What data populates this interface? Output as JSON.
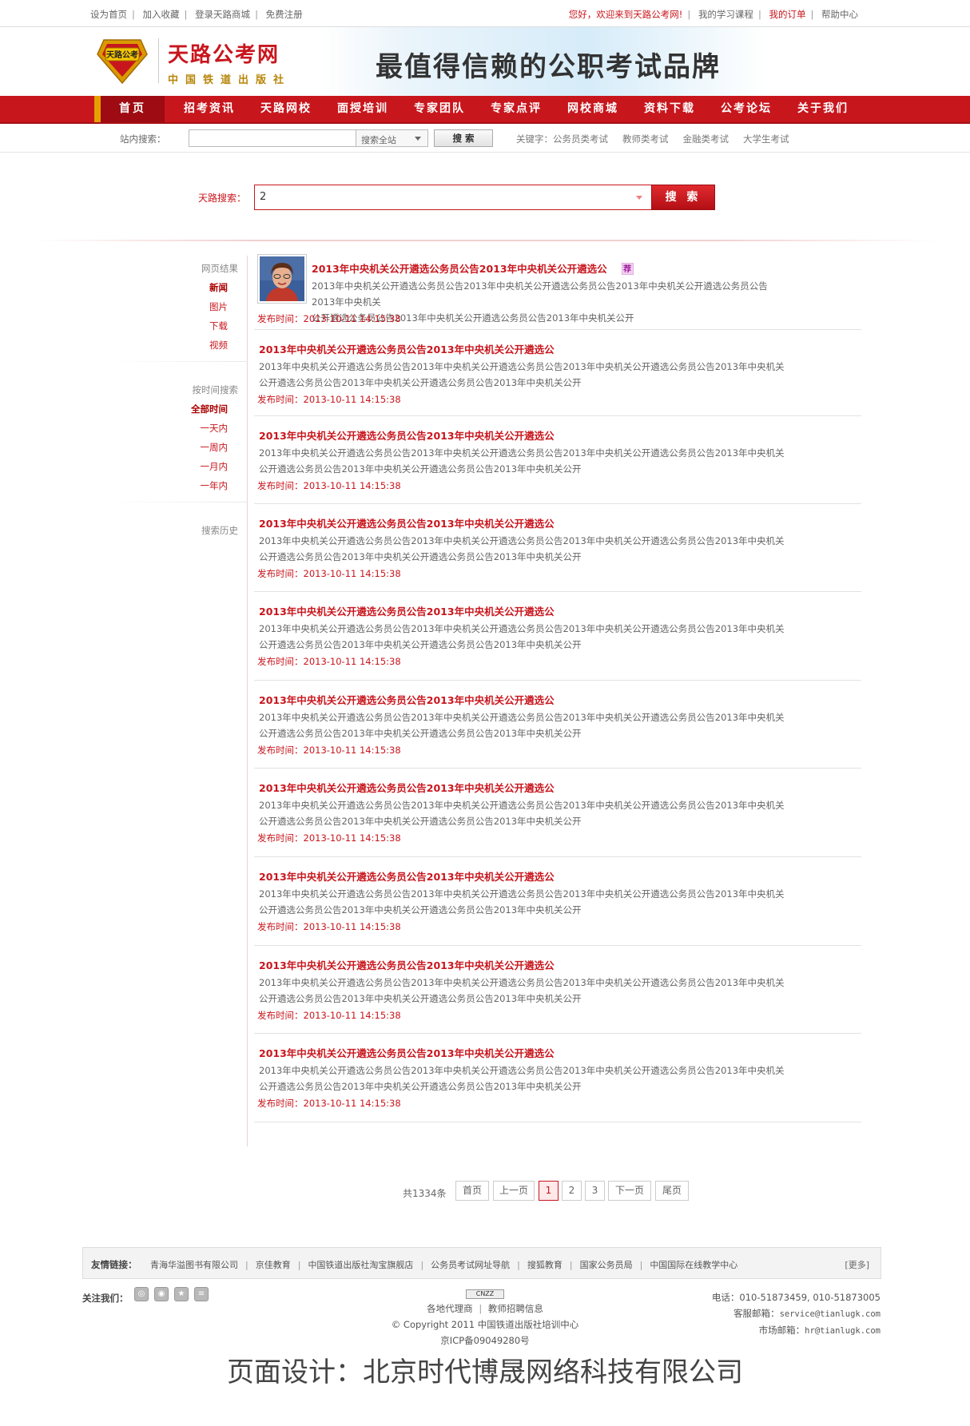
{
  "topbar": {
    "left_links": [
      "设为首页",
      "加入收藏",
      "登录天路商城",
      "免费注册"
    ],
    "welcome": "您好，欢迎来到天路公考网!",
    "right_links": [
      "我的学习课程",
      "我的订单",
      "帮助中心"
    ]
  },
  "header": {
    "logo_badge_text": "天路公考",
    "logo_title": "天路公考网",
    "logo_subtitle": "中国铁道出版社",
    "slogan": "最值得信赖的公职考试品牌"
  },
  "nav": {
    "home": "首页",
    "items": [
      "招考资讯",
      "天路网校",
      "面授培训",
      "专家团队",
      "专家点评",
      "网校商城",
      "资料下载",
      "公考论坛",
      "关于我们"
    ]
  },
  "site_search": {
    "label": "站内搜索：",
    "input_value": "",
    "select_value": "搜索全站",
    "button": "搜 索",
    "keywords_label": "关键字：",
    "keywords": [
      "公务员类考试",
      "教师类考试",
      "金融类考试",
      "大学生考试"
    ]
  },
  "main_search": {
    "label": "天路搜索：",
    "value": "2",
    "button": "搜 索"
  },
  "sidebar": {
    "sections": [
      {
        "heading": "网页结果",
        "items": [
          "新闻",
          "图片",
          "下载",
          "视频"
        ],
        "active": "新闻"
      },
      {
        "heading": "按时间搜索",
        "items": [
          "全部时间",
          "一天内",
          "一周内",
          "一月内",
          "一年内"
        ],
        "active": "全部时间"
      },
      {
        "heading": "搜索历史",
        "items": []
      }
    ]
  },
  "results": [
    {
      "title": "2013年中央机关公开遴选公务员公告2013年中央机关公开遴选公",
      "badge": "荐",
      "has_photo": true,
      "desc_line1": "2013年中央机关公开遴选公务员公告2013年中央机关公开遴选公务员公告2013年中央机关公开遴选公务员公告2013年中央机关",
      "desc_line2": "公开遴选公务员公告2013年中央机关公开遴选公务员公告2013年中央机关公开",
      "date_label": "发布时间：",
      "date": "2013-10-11 14:15:38"
    },
    {
      "title": "2013年中央机关公开遴选公务员公告2013年中央机关公开遴选公",
      "desc_line1": "2013年中央机关公开遴选公务员公告2013年中央机关公开遴选公务员公告2013年中央机关公开遴选公务员公告2013年中央机关",
      "desc_line2": "公开遴选公务员公告2013年中央机关公开遴选公务员公告2013年中央机关公开",
      "date_label": "发布时间：",
      "date": "2013-10-11 14:15:38"
    },
    {
      "title": "2013年中央机关公开遴选公务员公告2013年中央机关公开遴选公",
      "desc_line1": "2013年中央机关公开遴选公务员公告2013年中央机关公开遴选公务员公告2013年中央机关公开遴选公务员公告2013年中央机关",
      "desc_line2": "公开遴选公务员公告2013年中央机关公开遴选公务员公告2013年中央机关公开",
      "date_label": "发布时间：",
      "date": "2013-10-11 14:15:38"
    },
    {
      "title": "2013年中央机关公开遴选公务员公告2013年中央机关公开遴选公",
      "desc_line1": "2013年中央机关公开遴选公务员公告2013年中央机关公开遴选公务员公告2013年中央机关公开遴选公务员公告2013年中央机关",
      "desc_line2": "公开遴选公务员公告2013年中央机关公开遴选公务员公告2013年中央机关公开",
      "date_label": "发布时间：",
      "date": "2013-10-11 14:15:38"
    },
    {
      "title": "2013年中央机关公开遴选公务员公告2013年中央机关公开遴选公",
      "desc_line1": "2013年中央机关公开遴选公务员公告2013年中央机关公开遴选公务员公告2013年中央机关公开遴选公务员公告2013年中央机关",
      "desc_line2": "公开遴选公务员公告2013年中央机关公开遴选公务员公告2013年中央机关公开",
      "date_label": "发布时间：",
      "date": "2013-10-11 14:15:38"
    },
    {
      "title": "2013年中央机关公开遴选公务员公告2013年中央机关公开遴选公",
      "desc_line1": "2013年中央机关公开遴选公务员公告2013年中央机关公开遴选公务员公告2013年中央机关公开遴选公务员公告2013年中央机关",
      "desc_line2": "公开遴选公务员公告2013年中央机关公开遴选公务员公告2013年中央机关公开",
      "date_label": "发布时间：",
      "date": "2013-10-11 14:15:38"
    },
    {
      "title": "2013年中央机关公开遴选公务员公告2013年中央机关公开遴选公",
      "desc_line1": "2013年中央机关公开遴选公务员公告2013年中央机关公开遴选公务员公告2013年中央机关公开遴选公务员公告2013年中央机关",
      "desc_line2": "公开遴选公务员公告2013年中央机关公开遴选公务员公告2013年中央机关公开",
      "date_label": "发布时间：",
      "date": "2013-10-11 14:15:38"
    },
    {
      "title": "2013年中央机关公开遴选公务员公告2013年中央机关公开遴选公",
      "desc_line1": "2013年中央机关公开遴选公务员公告2013年中央机关公开遴选公务员公告2013年中央机关公开遴选公务员公告2013年中央机关",
      "desc_line2": "公开遴选公务员公告2013年中央机关公开遴选公务员公告2013年中央机关公开",
      "date_label": "发布时间：",
      "date": "2013-10-11 14:15:38"
    },
    {
      "title": "2013年中央机关公开遴选公务员公告2013年中央机关公开遴选公",
      "desc_line1": "2013年中央机关公开遴选公务员公告2013年中央机关公开遴选公务员公告2013年中央机关公开遴选公务员公告2013年中央机关",
      "desc_line2": "公开遴选公务员公告2013年中央机关公开遴选公务员公告2013年中央机关公开",
      "date_label": "发布时间：",
      "date": "2013-10-11 14:15:38"
    },
    {
      "title": "2013年中央机关公开遴选公务员公告2013年中央机关公开遴选公",
      "desc_line1": "2013年中央机关公开遴选公务员公告2013年中央机关公开遴选公务员公告2013年中央机关公开遴选公务员公告2013年中央机关",
      "desc_line2": "公开遴选公务员公告2013年中央机关公开遴选公务员公告2013年中央机关公开",
      "date_label": "发布时间：",
      "date": "2013-10-11 14:15:38"
    }
  ],
  "pager": {
    "total": "共1334条",
    "first": "首页",
    "prev": "上一页",
    "pages": [
      "1",
      "2",
      "3"
    ],
    "current": "1",
    "next": "下一页",
    "last": "尾页"
  },
  "friend_links": {
    "label": "友情链接：",
    "items": [
      "青海华溢图书有限公司",
      "京佳教育",
      "中国铁道出版社淘宝旗舰店",
      "公务员考试网址导航",
      "搜狐教育",
      "国家公务员局",
      "中国国际在线教学中心"
    ],
    "more": "[更多]"
  },
  "footer": {
    "follow_label": "关注我们：",
    "counter_badge": "CNZZ",
    "links": [
      "各地代理商",
      "教师招聘信息"
    ],
    "copyright": "© Copyright 2011 中国铁道出版社培训中心",
    "icp": "京ICP备09049280号",
    "phone_label": "电话：",
    "phone": "010-51873459, 010-51873005",
    "service_label": "客服邮箱：",
    "service_email": "service@tianlugk.com",
    "market_label": "市场邮箱：",
    "market_email": "hr@tianlugk.com"
  },
  "credit": "页面设计：北京时代博晟网络科技有限公司",
  "colors": {
    "brand_red": "#c8161d",
    "nav_dark": "#9e0b12",
    "accent_gold": "#e5a000"
  }
}
